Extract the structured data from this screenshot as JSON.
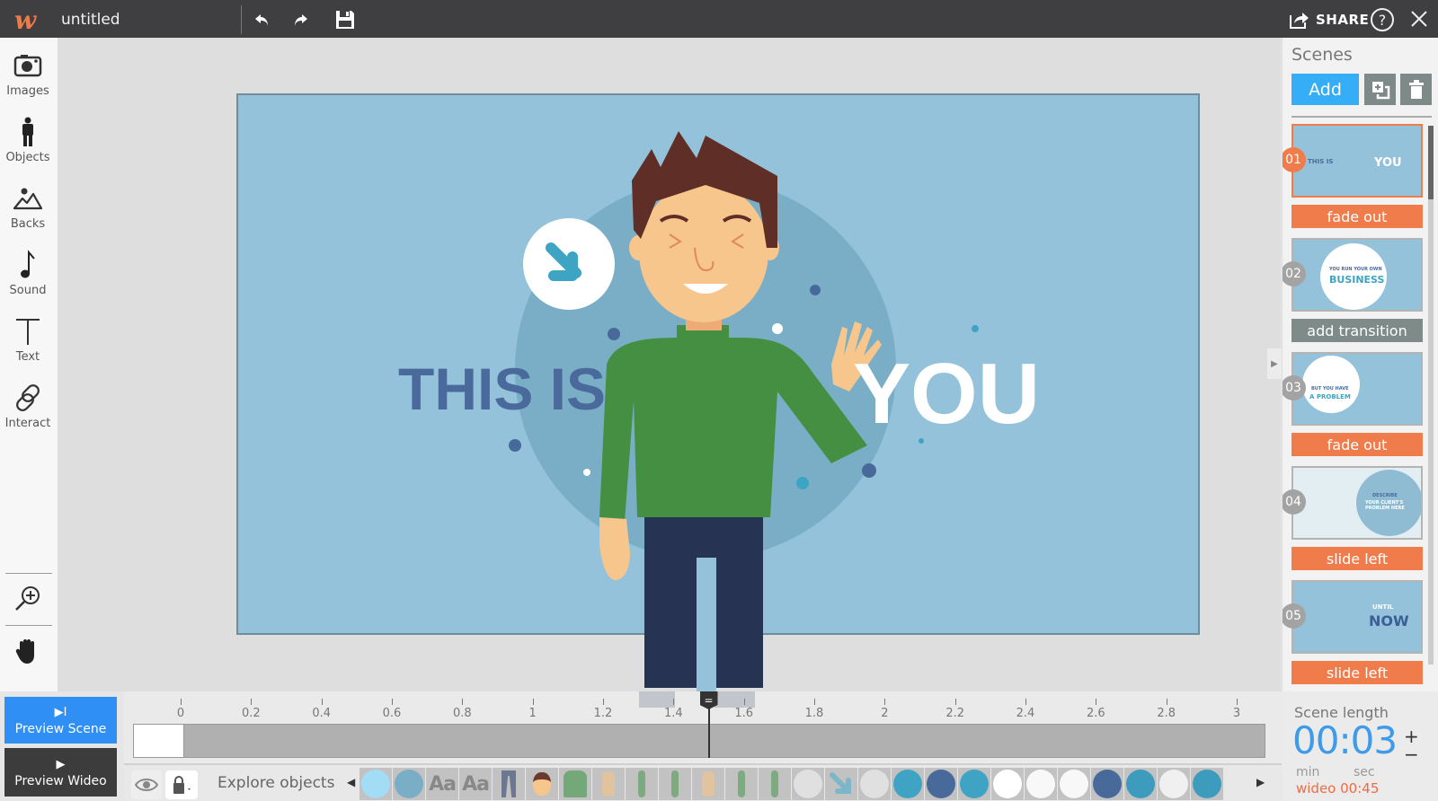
{
  "topbar": {
    "logo": "w",
    "title": "untitled",
    "share_label": "SHARE",
    "help_label": "?"
  },
  "tools": [
    {
      "label": "Images",
      "icon": "camera-icon"
    },
    {
      "label": "Objects",
      "icon": "person-icon"
    },
    {
      "label": "Backs",
      "icon": "mountain-icon"
    },
    {
      "label": "Sound",
      "icon": "music-note-icon"
    },
    {
      "label": "Text",
      "icon": "text-icon"
    },
    {
      "label": "Interact",
      "icon": "link-icon"
    }
  ],
  "preview": {
    "scene_glyph": "▶I",
    "scene_label": "Preview Scene",
    "wideo_glyph": "▶",
    "wideo_label": "Preview Wideo"
  },
  "stage": {
    "text_left": "THIS IS",
    "text_right": "YOU",
    "colors": {
      "background": "#93c2da",
      "circle": "#7aaec6",
      "text_left": "#4a6a9c",
      "text_right": "#ffffff",
      "shirt": "#448f42",
      "skin": "#f6c68c",
      "hair": "#5f2e26",
      "pants": "#263352",
      "arrow": "#3da4c3"
    }
  },
  "scenes": {
    "title": "Scenes",
    "add_label": "Add",
    "items": [
      {
        "num": "01",
        "caption_1": "THIS IS",
        "caption_2": "YOU",
        "transition": "fade out",
        "active": true
      },
      {
        "num": "02",
        "caption_1": "YOU RUN YOUR OWN",
        "caption_2": "BUSINESS",
        "transition": "add transition",
        "active": false
      },
      {
        "num": "03",
        "caption_1": "BUT YOU HAVE",
        "caption_2": "A PROBLEM",
        "transition": "fade out",
        "active": false
      },
      {
        "num": "04",
        "caption_1": "DESCRIBE",
        "caption_2": "YOUR CLIENT'S PROBLEM HERE",
        "transition": "slide left",
        "active": false
      },
      {
        "num": "05",
        "caption_1": "UNTIL",
        "caption_2": "NOW",
        "transition": "slide left",
        "active": false
      }
    ]
  },
  "timeline": {
    "ticks": [
      "0",
      "0.2",
      "0.4",
      "0.6",
      "0.8",
      "1",
      "1.2",
      "1.4",
      "1.6",
      "1.8",
      "2",
      "2.2",
      "2.4",
      "2.6",
      "2.8",
      "3"
    ],
    "playhead_seconds": 1.5,
    "playhead_glyph": "="
  },
  "objects_bar": {
    "explore_label": "Explore objects",
    "items": [
      {
        "type": "dot",
        "color": "#a3dcf5"
      },
      {
        "type": "dot",
        "color": "#79aec6"
      },
      {
        "type": "text",
        "label": "Aa"
      },
      {
        "type": "text",
        "label": "Aa"
      },
      {
        "type": "pants",
        "color": "#6b7890"
      },
      {
        "type": "face",
        "color": "#f6c68c"
      },
      {
        "type": "shirt",
        "color": "#75a878"
      },
      {
        "type": "hand",
        "color": "#e2c3a0"
      },
      {
        "type": "bar",
        "color": "#7eaa80"
      },
      {
        "type": "bar",
        "color": "#7eaa80"
      },
      {
        "type": "hand",
        "color": "#e2c3a0"
      },
      {
        "type": "bar",
        "color": "#7eaa80"
      },
      {
        "type": "bar",
        "color": "#7eaa80"
      },
      {
        "type": "dot",
        "color": "#e0e0e0"
      },
      {
        "type": "arrow",
        "color": "#7db6c9"
      },
      {
        "type": "dot",
        "color": "#e0e0e0"
      },
      {
        "type": "dot",
        "color": "#3fa4c4"
      },
      {
        "type": "dot",
        "color": "#486a9a"
      },
      {
        "type": "dot",
        "color": "#3fa4c4"
      },
      {
        "type": "dot",
        "color": "#ffffff"
      },
      {
        "type": "dot",
        "color": "#f8f8f8"
      },
      {
        "type": "dot",
        "color": "#f8f8f8"
      },
      {
        "type": "dot",
        "color": "#486a9a"
      },
      {
        "type": "dot",
        "color": "#3d9bbd"
      },
      {
        "type": "dot",
        "color": "#f0f0f0"
      },
      {
        "type": "dot",
        "color": "#3d9bbd"
      }
    ]
  },
  "scene_length": {
    "title": "Scene length",
    "value": "00:03",
    "plus": "+",
    "minus": "−",
    "min_label": "min",
    "sec_label": "sec",
    "total": "wideo 00:45"
  }
}
